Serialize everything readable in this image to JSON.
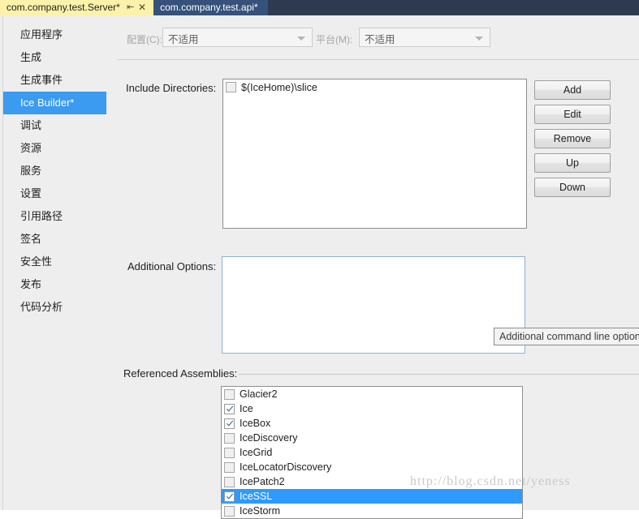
{
  "tabs": [
    {
      "title": "com.company.test.Server*",
      "active": true,
      "pin_icon": "pin-icon",
      "close_icon": "close-icon",
      "pin_glyph": "⇥",
      "close_glyph": "✕"
    },
    {
      "title": "com.company.test.api*",
      "active": false
    }
  ],
  "sidebar": {
    "items": [
      {
        "label": "应用程序",
        "selected": false
      },
      {
        "label": "生成",
        "selected": false
      },
      {
        "label": "生成事件",
        "selected": false
      },
      {
        "label": "Ice Builder*",
        "selected": true
      },
      {
        "label": "调试",
        "selected": false
      },
      {
        "label": "资源",
        "selected": false
      },
      {
        "label": "服务",
        "selected": false
      },
      {
        "label": "设置",
        "selected": false
      },
      {
        "label": "引用路径",
        "selected": false
      },
      {
        "label": "签名",
        "selected": false
      },
      {
        "label": "安全性",
        "selected": false
      },
      {
        "label": "发布",
        "selected": false
      },
      {
        "label": "代码分析",
        "selected": false
      }
    ]
  },
  "config_row": {
    "configuration_label": "配置(C):",
    "configuration_value": "不适用",
    "platform_label": "平台(M):",
    "platform_value": "不适用"
  },
  "include_directories": {
    "label": "Include Directories:",
    "items": [
      {
        "text": "$(IceHome)\\slice",
        "checked": false,
        "selected": false
      }
    ]
  },
  "buttons": {
    "add": "Add",
    "edit": "Edit",
    "remove": "Remove",
    "up": "Up",
    "down": "Down"
  },
  "additional_options": {
    "label": "Additional Options:",
    "value": "",
    "tooltip": "Additional command line options"
  },
  "referenced_assemblies": {
    "label": "Referenced Assemblies:",
    "items": [
      {
        "text": "Glacier2",
        "checked": false,
        "selected": false
      },
      {
        "text": "Ice",
        "checked": true,
        "selected": false
      },
      {
        "text": "IceBox",
        "checked": true,
        "selected": false
      },
      {
        "text": "IceDiscovery",
        "checked": false,
        "selected": false
      },
      {
        "text": "IceGrid",
        "checked": false,
        "selected": false
      },
      {
        "text": "IceLocatorDiscovery",
        "checked": false,
        "selected": false
      },
      {
        "text": "IcePatch2",
        "checked": false,
        "selected": false
      },
      {
        "text": "IceSSL",
        "checked": true,
        "selected": true
      },
      {
        "text": "IceStorm",
        "checked": false,
        "selected": false
      }
    ]
  },
  "watermark": "http://blog.csdn.net/yeness",
  "colors": {
    "tab_active_bg": "#fdf2ab",
    "tab_inactive_bg": "#36517a",
    "tabstrip_bg": "#2d3a50",
    "selection_blue": "#3a9bf0",
    "list_selection_blue": "#2e9afe",
    "panel_bg": "#eeeeee"
  }
}
